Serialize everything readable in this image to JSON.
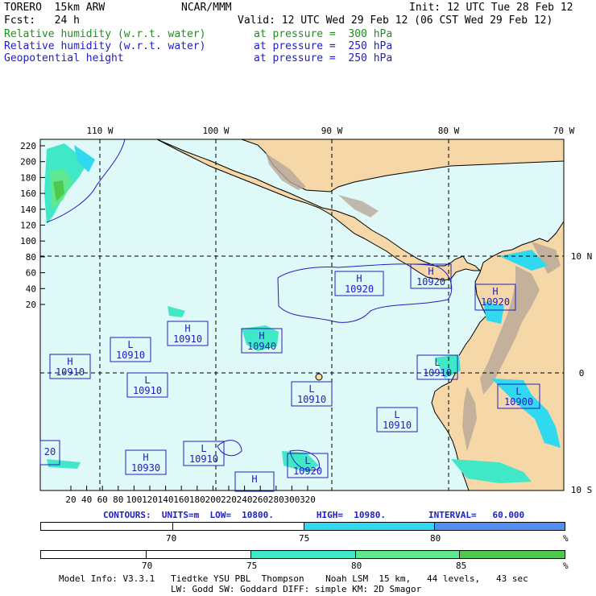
{
  "header": {
    "model_line": "TORERO  15km ARW",
    "center": "NCAR/MMM",
    "init": "Init: 12 UTC Tue 28 Feb 12",
    "fcst": "Fcst:   24 h",
    "valid": "Valid: 12 UTC Wed 29 Feb 12 (06 CST Wed 29 Feb 12)",
    "fields": [
      {
        "name": "Relative humidity (w.r.t. water)",
        "level": "at pressure =  300 hPa",
        "color": "#1f8f1f"
      },
      {
        "name": "Relative humidity (w.r.t. water)",
        "level": "at pressure =  250 hPa",
        "color": "#2020c0"
      },
      {
        "name": "Geopotential height",
        "level": "at pressure =  250 hPa",
        "color": "#2020c0"
      }
    ]
  },
  "map": {
    "top_lon_labels": [
      "110 W",
      "100 W",
      "90 W",
      "80 W",
      "70 W"
    ],
    "right_lat_labels": [
      "10 N",
      "0",
      "10 S"
    ],
    "left_ticks": [
      "220",
      "200",
      "180",
      "160",
      "140",
      "120",
      "100",
      "80",
      "60",
      "40",
      "20"
    ],
    "bottom_ticks": [
      "20",
      "40",
      "60",
      "80",
      "100",
      "120",
      "140",
      "160",
      "180",
      "200",
      "220",
      "240",
      "260",
      "280",
      "300",
      "320"
    ],
    "ocean_color": "#dff8f8",
    "land_color": "#f5d7a8",
    "pressure_centers": [
      {
        "type": "H",
        "value": "10910"
      },
      {
        "type": "L",
        "value": "10910"
      },
      {
        "type": "H",
        "value": "10910"
      },
      {
        "type": "H",
        "value": "10940"
      },
      {
        "type": "L",
        "value": "10910"
      },
      {
        "type": "H",
        "value": "10920"
      },
      {
        "type": "H",
        "value": "10920"
      },
      {
        "type": "H",
        "value": "10920"
      },
      {
        "type": "L",
        "value": "10910"
      },
      {
        "type": "L",
        "value": "10910"
      },
      {
        "type": "L",
        "value": "10910"
      },
      {
        "type": "L",
        "value": "10900"
      },
      {
        "type": "H",
        "value": "10930"
      },
      {
        "type": "L",
        "value": "10910"
      },
      {
        "type": "L",
        "value": "10920"
      },
      {
        "type": "H",
        "value": ""
      },
      {
        "type": "",
        "value": "20"
      }
    ]
  },
  "contour_line": "CONTOURS:  UNITS=m  LOW=  10800.        HIGH=  10980.        INTERVAL=   60.000",
  "colorbar_250": {
    "labels": [
      "70",
      "75",
      "80",
      "%"
    ],
    "colors": [
      "#ffffff",
      "#ffffff",
      "#30d8f0",
      "#5090f0"
    ]
  },
  "colorbar_300": {
    "labels": [
      "70",
      "75",
      "80",
      "85",
      "%"
    ],
    "colors": [
      "#ffffff",
      "#ffffff",
      "#40e8c8",
      "#60e890",
      "#50c850"
    ]
  },
  "footer": {
    "line1": "Model Info: V3.3.1   Tiedtke YSU PBL  Thompson    Noah LSM  15 km,   44 levels,   43 sec",
    "line2": "LW: Godd SW: Goddard DIFF: simple KM: 2D Smagor"
  }
}
